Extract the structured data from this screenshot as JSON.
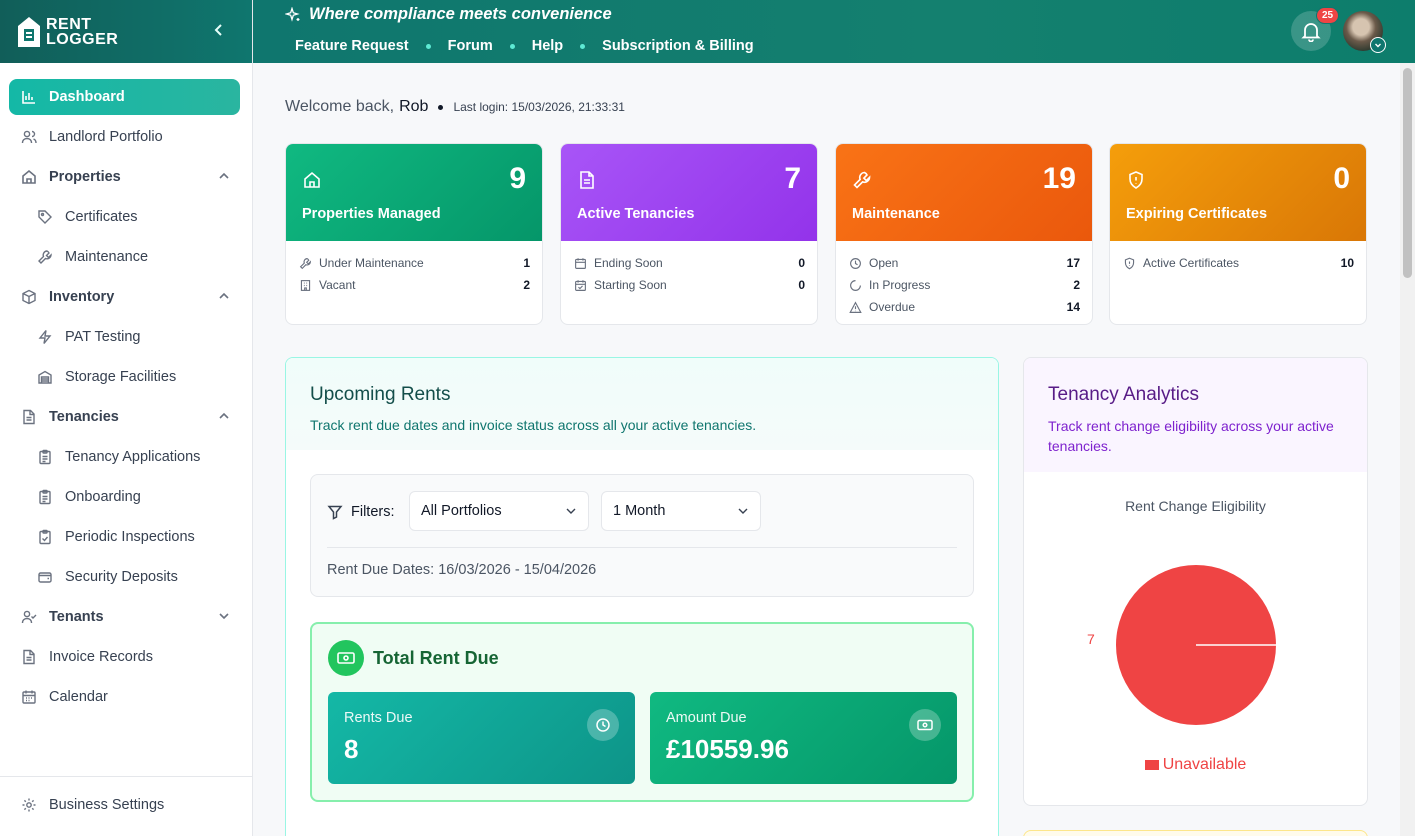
{
  "brand": {
    "line1": "RENT",
    "line2": "LOGGER"
  },
  "header": {
    "tagline": "Where compliance meets convenience",
    "links": [
      "Feature Request",
      "Forum",
      "Help",
      "Subscription & Billing"
    ],
    "notification_count": "25"
  },
  "sidebar": {
    "items": [
      {
        "label": "Dashboard",
        "icon": "bar-chart-icon"
      },
      {
        "label": "Landlord Portfolio",
        "icon": "users-icon"
      },
      {
        "label": "Properties",
        "icon": "home-icon"
      },
      {
        "label": "Certificates",
        "icon": "tag-icon"
      },
      {
        "label": "Maintenance",
        "icon": "wrench-icon"
      },
      {
        "label": "Inventory",
        "icon": "box-icon"
      },
      {
        "label": "PAT Testing",
        "icon": "bolt-icon"
      },
      {
        "label": "Storage Facilities",
        "icon": "warehouse-icon"
      },
      {
        "label": "Tenancies",
        "icon": "document-icon"
      },
      {
        "label": "Tenancy Applications",
        "icon": "clipboard-icon"
      },
      {
        "label": "Onboarding",
        "icon": "clipboard-icon"
      },
      {
        "label": "Periodic Inspections",
        "icon": "clipboard-check-icon"
      },
      {
        "label": "Security Deposits",
        "icon": "wallet-icon"
      },
      {
        "label": "Tenants",
        "icon": "user-check-icon"
      },
      {
        "label": "Invoice Records",
        "icon": "document-icon"
      },
      {
        "label": "Calendar",
        "icon": "calendar-icon"
      }
    ],
    "settings": "Business Settings"
  },
  "welcome": {
    "prefix": "Welcome back,",
    "name": "Rob",
    "last_login": "Last login: 15/03/2026, 21:33:31"
  },
  "stats": [
    {
      "title": "Properties Managed",
      "value": "9",
      "color": "#10b981",
      "rows": [
        {
          "label": "Under Maintenance",
          "value": "1"
        },
        {
          "label": "Vacant",
          "value": "2"
        }
      ]
    },
    {
      "title": "Active Tenancies",
      "value": "7",
      "color": "#a855f7",
      "rows": [
        {
          "label": "Ending Soon",
          "value": "0"
        },
        {
          "label": "Starting Soon",
          "value": "0"
        }
      ]
    },
    {
      "title": "Maintenance",
      "value": "19",
      "color": "#f97316",
      "rows": [
        {
          "label": "Open",
          "value": "17"
        },
        {
          "label": "In Progress",
          "value": "2"
        },
        {
          "label": "Overdue",
          "value": "14"
        }
      ]
    },
    {
      "title": "Expiring Certificates",
      "value": "0",
      "color": "#f59e0b",
      "rows": [
        {
          "label": "Active Certificates",
          "value": "10"
        }
      ]
    }
  ],
  "upcoming_rents": {
    "title": "Upcoming Rents",
    "subtitle": "Track rent due dates and invoice status across all your active tenancies.",
    "filters_label": "Filters:",
    "portfolio_select": "All Portfolios",
    "period_select": "1 Month",
    "date_range": "Rent Due Dates: 16/03/2026 - 15/04/2026",
    "total_title": "Total Rent Due",
    "rents_due_label": "Rents Due",
    "rents_due_value": "8",
    "amount_due_label": "Amount Due",
    "amount_due_value": "£10559.96"
  },
  "analytics": {
    "title": "Tenancy Analytics",
    "subtitle": "Track rent change eligibility across your active tenancies.",
    "chart_data": {
      "type": "pie",
      "title": "Rent Change Eligibility",
      "categories": [
        "Unavailable"
      ],
      "values": [
        7
      ],
      "colors": [
        "#ef4444"
      ],
      "legend": "bottom"
    }
  }
}
